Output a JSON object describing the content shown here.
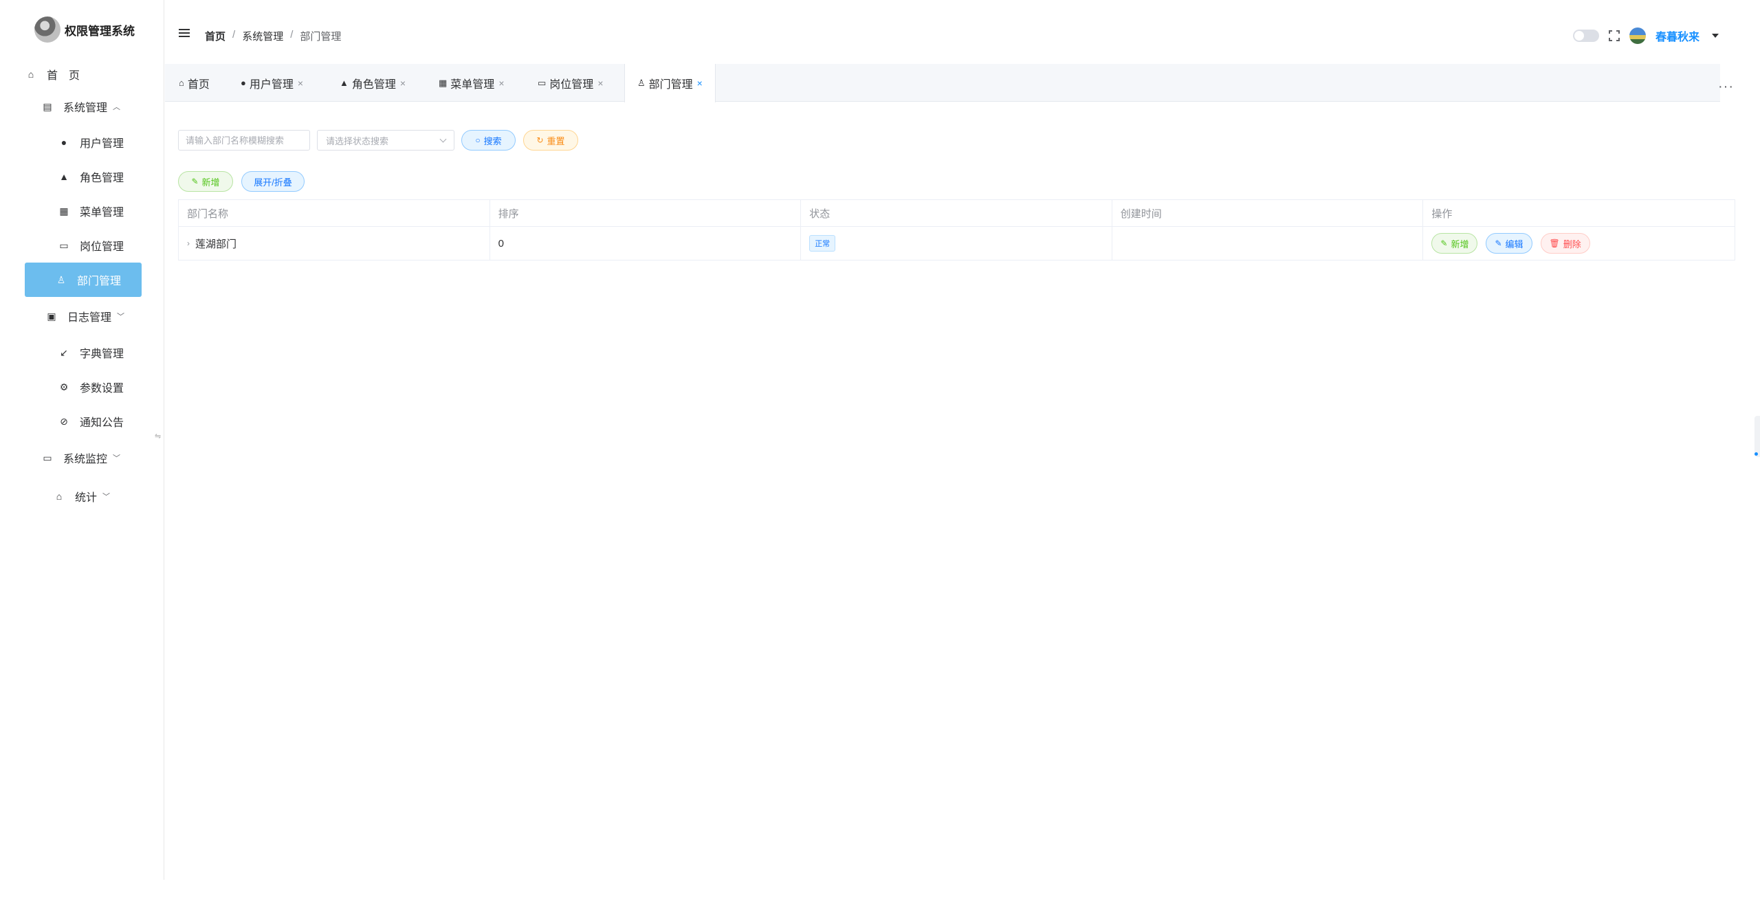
{
  "app": {
    "title": "权限管理系统"
  },
  "sidebar": {
    "items": [
      {
        "label": "首　页",
        "icon": "home-icon"
      },
      {
        "label": "系统管理",
        "icon": "system-icon",
        "expanded": true
      },
      {
        "label": "用户管理",
        "icon": "user-icon"
      },
      {
        "label": "角色管理",
        "icon": "role-icon"
      },
      {
        "label": "菜单管理",
        "icon": "menu-grid-icon"
      },
      {
        "label": "岗位管理",
        "icon": "post-icon"
      },
      {
        "label": "部门管理",
        "icon": "dept-icon",
        "active": true
      },
      {
        "label": "日志管理",
        "icon": "calendar-icon",
        "expanded": false
      },
      {
        "label": "字典管理",
        "icon": "dict-icon"
      },
      {
        "label": "参数设置",
        "icon": "settings-icon"
      },
      {
        "label": "通知公告",
        "icon": "notice-icon"
      },
      {
        "label": "系统监控",
        "icon": "monitor-icon",
        "expanded": false
      },
      {
        "label": "统计",
        "icon": "stats-icon",
        "expanded": false
      }
    ]
  },
  "header": {
    "breadcrumb": [
      "首页",
      "系统管理",
      "部门管理"
    ],
    "breadcrumb_sep": "/",
    "user_name": "春暮秋来"
  },
  "tabs": [
    {
      "label": "首页",
      "icon": "home-icon"
    },
    {
      "label": "用户管理",
      "icon": "user-icon",
      "closable": true
    },
    {
      "label": "角色管理",
      "icon": "role-icon",
      "closable": true
    },
    {
      "label": "菜单管理",
      "icon": "menu-grid-icon",
      "closable": true
    },
    {
      "label": "岗位管理",
      "icon": "post-icon",
      "closable": true
    },
    {
      "label": "部门管理",
      "icon": "dept-icon",
      "closable": true,
      "active": true
    }
  ],
  "search": {
    "dept_name_placeholder": "请输入部门名称模糊搜索",
    "status_placeholder": "请选择状态搜索",
    "search_label": "搜索",
    "reset_label": "重置"
  },
  "toolbar": {
    "add_label": "新增",
    "expand_label": "展开/折叠"
  },
  "table": {
    "columns": [
      "部门名称",
      "排序",
      "状态",
      "创建时间",
      "操作"
    ],
    "rows": [
      {
        "name": "莲湖部门",
        "order": "0",
        "status": "正常",
        "created": ""
      }
    ],
    "actions": {
      "add": "新增",
      "edit": "编辑",
      "delete": "删除"
    }
  },
  "colors": {
    "active_menu_bg": "#6cbdee",
    "primary": "#1677ff",
    "success": "#52c41a",
    "warning": "#fa8c16",
    "danger": "#ff4d4f"
  }
}
